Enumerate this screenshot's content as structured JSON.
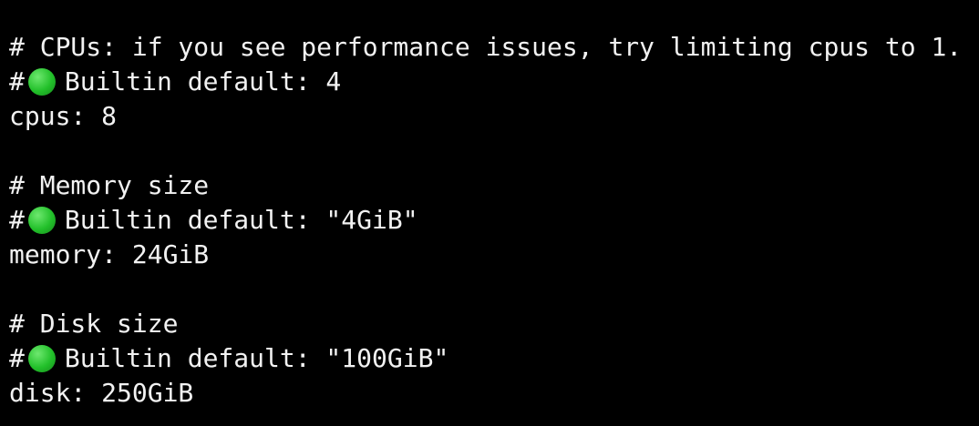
{
  "theme": {
    "background": "#000000",
    "text_color": "#f2f2f2",
    "indicator_color": "#22c02a"
  },
  "config": {
    "cpus": {
      "comment": "# CPUs: if you see performance issues, try limiting cpus to 1.",
      "default_prefix": "#",
      "default_icon": "green-circle-icon",
      "default_text": "Builtin default: 4",
      "setting": "cpus: 8"
    },
    "memory": {
      "comment": "# Memory size",
      "default_prefix": "#",
      "default_icon": "green-circle-icon",
      "default_text": "Builtin default: \"4GiB\"",
      "setting": "memory: 24GiB"
    },
    "disk": {
      "comment": "# Disk size",
      "default_prefix": "#",
      "default_icon": "green-circle-icon",
      "default_text": "Builtin default: \"100GiB\"",
      "setting": "disk: 250GiB"
    }
  }
}
